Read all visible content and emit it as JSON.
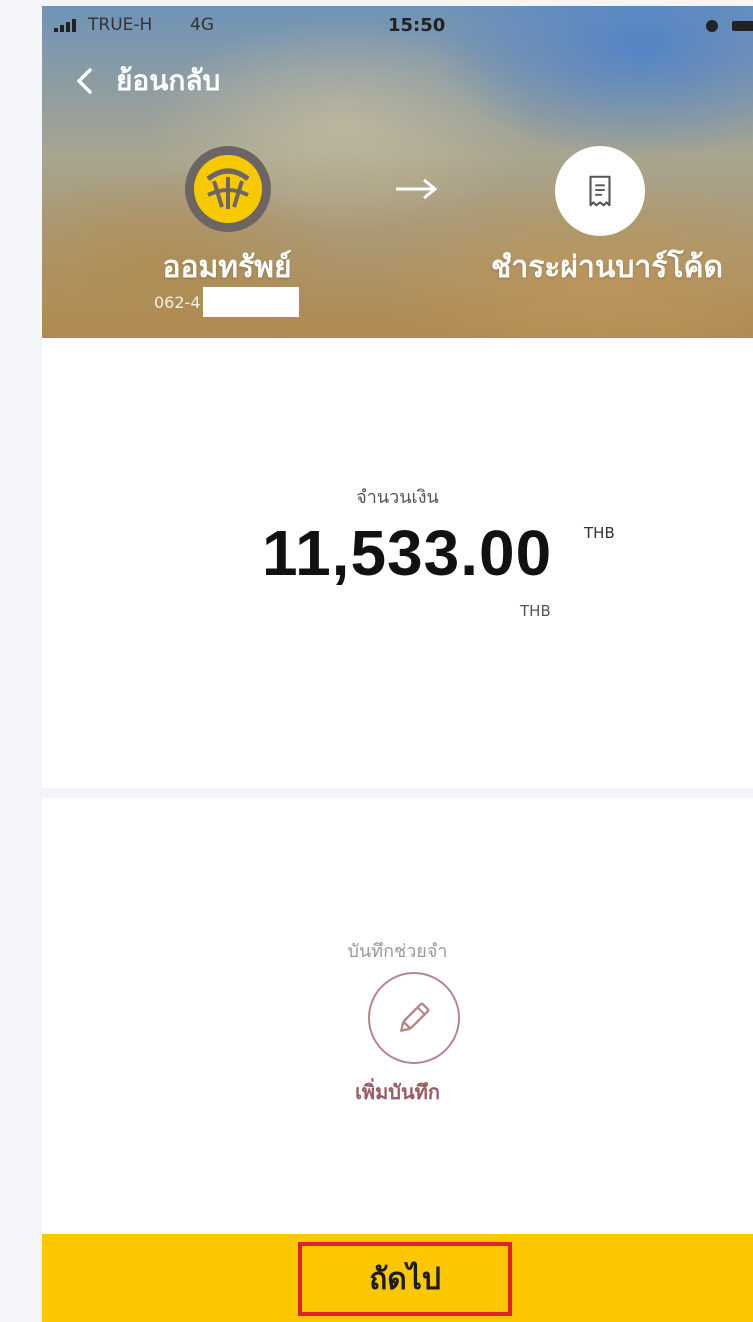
{
  "status_bar": {
    "carrier": "TRUE-H",
    "network": "4G",
    "time": "15:50",
    "icons": [
      "signal-icon",
      "alarm-icon",
      "battery-icon"
    ]
  },
  "nav": {
    "back_label": "ย้อนกลับ",
    "back_icon": "chevron-left-icon"
  },
  "transfer": {
    "from": {
      "name": "ออมทรัพย์",
      "account_prefix": "062-4",
      "logo_icon": "bank-logo-icon",
      "logo_color": "#f6c900"
    },
    "arrow_icon": "arrow-right-icon",
    "to": {
      "name": "ชำระผ่านบาร์โค้ด",
      "icon": "receipt-icon"
    }
  },
  "amount": {
    "label": "จำนวนเงิน",
    "value": "11,533.00",
    "currency_sup": "THB",
    "currency_sub": "THB"
  },
  "memo": {
    "title": "บันทึกช่วยจำ",
    "add_label": "เพิ่มบันทึก",
    "icon": "pencil-icon"
  },
  "footer": {
    "next_label": "ถัดไป",
    "bar_color": "#fbc800",
    "highlight_color": "#e5202d"
  }
}
